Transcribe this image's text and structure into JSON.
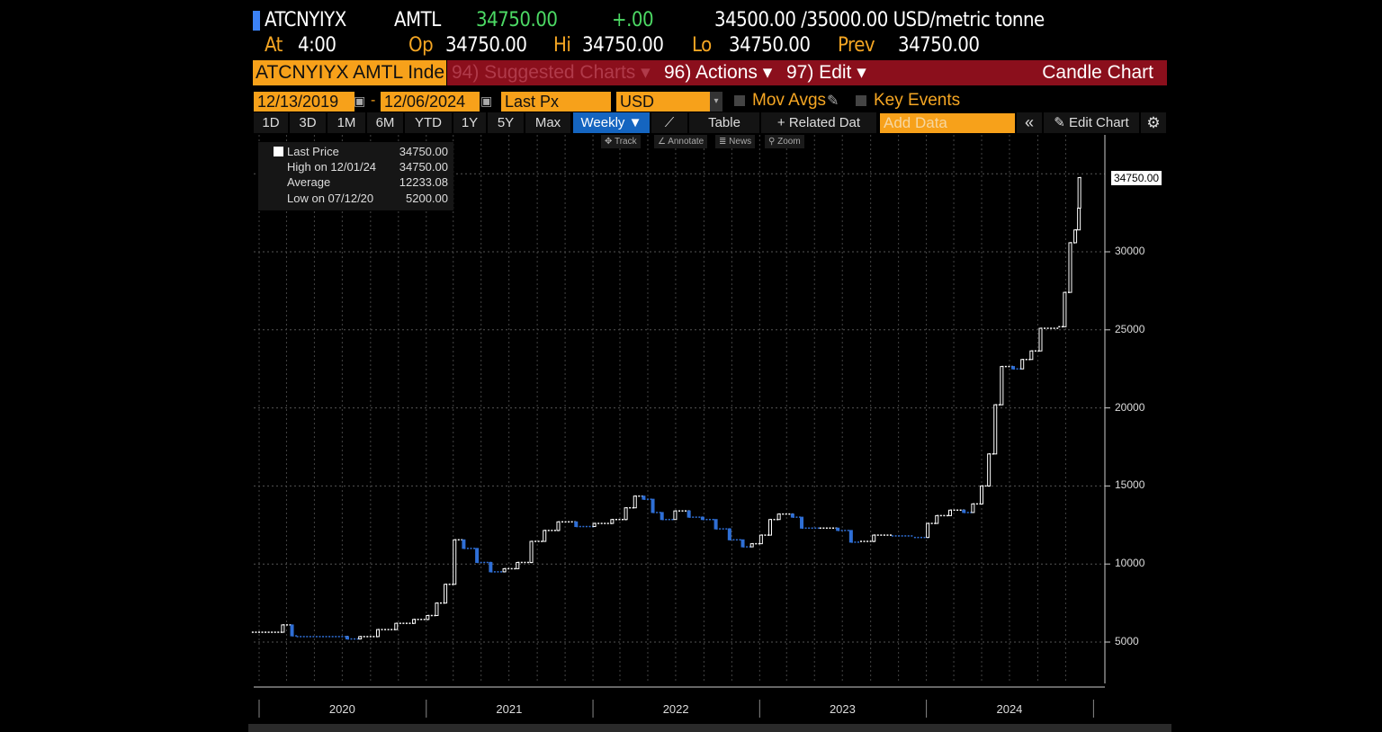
{
  "header": {
    "ticker": "ATCNYIYX",
    "source": "AMTL",
    "last": "34750.00",
    "change": "+.00",
    "bid_ask": "34500.00 /35000.00 USD/metric tonne",
    "at_label": "At",
    "at_time": "4:00",
    "op_label": "Op",
    "op": "34750.00",
    "hi_label": "Hi",
    "hi": "34750.00",
    "lo_label": "Lo",
    "lo": "34750.00",
    "prev_label": "Prev",
    "prev": "34750.00"
  },
  "menu": {
    "security": "ATCNYIYX AMTL Inde",
    "suggested": "94) Suggested Charts",
    "actions": "96) Actions",
    "edit": "97) Edit",
    "chart_type": "Candle Chart"
  },
  "controls": {
    "start_date": "12/13/2019",
    "end_date": "12/06/2024",
    "field": "Last Px",
    "currency": "USD",
    "mov_avgs": "Mov Avgs",
    "key_events": "Key Events"
  },
  "periods": [
    "1D",
    "3D",
    "1M",
    "6M",
    "YTD",
    "1Y",
    "5Y",
    "Max"
  ],
  "toolbar": {
    "frequency": "Weekly ▼",
    "table": "Table",
    "related": "+ Related Dat",
    "add_data_placeholder": "Add Data",
    "collapse": "«",
    "edit_chart": "Edit Chart"
  },
  "chart_tools": {
    "track": "Track",
    "annotate": "Annotate",
    "news": "News",
    "zoom": "Zoom"
  },
  "legend": [
    {
      "label": "Last Price",
      "value": "34750.00"
    },
    {
      "label": "High on 12/01/24",
      "value": "34750.00"
    },
    {
      "label": "Average",
      "value": "12233.08"
    },
    {
      "label": "Low on 07/12/20",
      "value": "5200.00"
    }
  ],
  "colors": {
    "up": "#ffffff",
    "down": "#2f6fd6",
    "menu_red": "#8b0f1c",
    "orange": "#f7a11a",
    "active_tab": "#1565c0"
  },
  "chart_data": {
    "type": "line",
    "title": "",
    "ylim": [
      3000,
      36500
    ],
    "yticks": [
      5000,
      10000,
      15000,
      20000,
      25000,
      30000
    ],
    "xticks": [
      "2020",
      "2021",
      "2022",
      "2023",
      "2024"
    ],
    "last_value_label": "34750.00",
    "grid": true,
    "series": [
      {
        "name": "Last Price",
        "points": [
          [
            "2019-12-16",
            5630
          ],
          [
            "2020-02-22",
            6100
          ],
          [
            "2020-03-13",
            5400
          ],
          [
            "2020-03-23",
            5350
          ],
          [
            "2020-07-10",
            5350
          ],
          [
            "2020-07-12",
            5200
          ],
          [
            "2020-08-09",
            5350
          ],
          [
            "2020-09-17",
            5800
          ],
          [
            "2020-10-27",
            6200
          ],
          [
            "2020-12-05",
            6450
          ],
          [
            "2021-01-04",
            6700
          ],
          [
            "2021-01-24",
            7500
          ],
          [
            "2021-02-12",
            8700
          ],
          [
            "2021-03-04",
            11550
          ],
          [
            "2021-03-24",
            11000
          ],
          [
            "2021-04-22",
            10100
          ],
          [
            "2021-05-22",
            9500
          ],
          [
            "2021-06-21",
            9700
          ],
          [
            "2021-07-20",
            10100
          ],
          [
            "2021-08-19",
            11450
          ],
          [
            "2021-09-17",
            12150
          ],
          [
            "2021-10-17",
            12700
          ],
          [
            "2021-11-25",
            12400
          ],
          [
            "2022-01-04",
            12600
          ],
          [
            "2022-02-12",
            12850
          ],
          [
            "2022-03-14",
            13600
          ],
          [
            "2022-04-03",
            14350
          ],
          [
            "2022-04-22",
            14150
          ],
          [
            "2022-05-12",
            13300
          ],
          [
            "2022-06-01",
            12850
          ],
          [
            "2022-06-30",
            13400
          ],
          [
            "2022-07-30",
            13000
          ],
          [
            "2022-08-29",
            12850
          ],
          [
            "2022-09-27",
            12250
          ],
          [
            "2022-10-27",
            11550
          ],
          [
            "2022-11-25",
            11100
          ],
          [
            "2022-12-15",
            11300
          ],
          [
            "2023-01-04",
            11850
          ],
          [
            "2023-01-24",
            12850
          ],
          [
            "2023-02-12",
            13200
          ],
          [
            "2023-03-14",
            13000
          ],
          [
            "2023-04-03",
            12300
          ],
          [
            "2023-05-12",
            12300
          ],
          [
            "2023-06-21",
            12150
          ],
          [
            "2023-07-20",
            11400
          ],
          [
            "2023-08-09",
            11450
          ],
          [
            "2023-09-08",
            11850
          ],
          [
            "2023-10-17",
            11800
          ],
          [
            "2023-12-05",
            11700
          ],
          [
            "2024-01-04",
            12600
          ],
          [
            "2024-01-24",
            13100
          ],
          [
            "2024-02-22",
            13450
          ],
          [
            "2024-03-23",
            13300
          ],
          [
            "2024-04-12",
            13850
          ],
          [
            "2024-05-01",
            15000
          ],
          [
            "2024-05-17",
            17050
          ],
          [
            "2024-05-31",
            20200
          ],
          [
            "2024-06-14",
            22650
          ],
          [
            "2024-07-09",
            22500
          ],
          [
            "2024-07-29",
            23100
          ],
          [
            "2024-08-18",
            23650
          ],
          [
            "2024-09-07",
            25100
          ],
          [
            "2024-10-16",
            25200
          ],
          [
            "2024-10-30",
            27400
          ],
          [
            "2024-11-11",
            30580
          ],
          [
            "2024-11-22",
            31400
          ],
          [
            "2024-11-30",
            32800
          ],
          [
            "2024-12-01",
            34750
          ]
        ]
      }
    ]
  }
}
